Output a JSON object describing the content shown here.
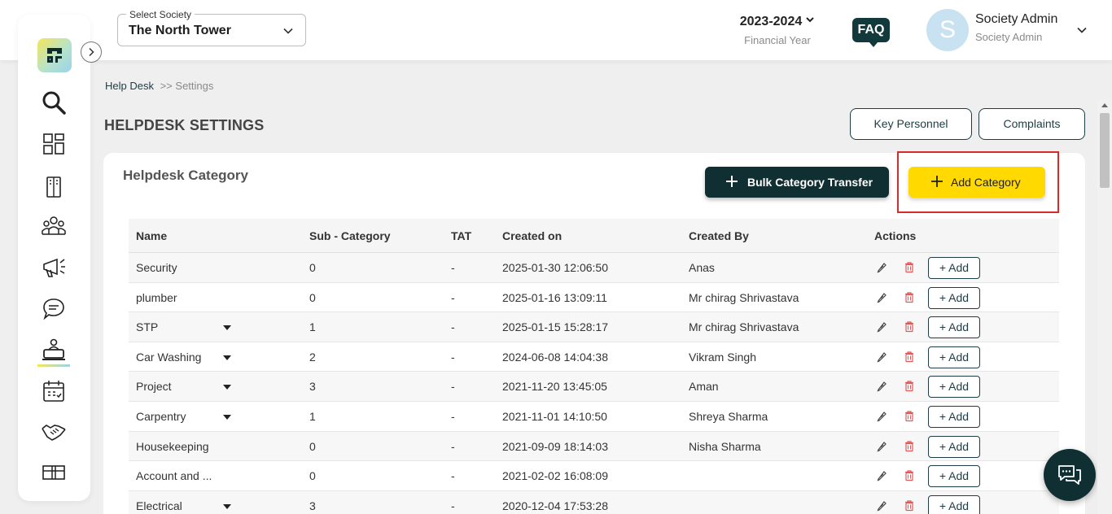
{
  "header": {
    "society_select": {
      "label": "Select Society",
      "value": "The North Tower"
    },
    "financial_year": {
      "value": "2023-2024",
      "label": "Financial Year"
    },
    "faq_label": "FAQ",
    "user": {
      "initial": "S",
      "name": "Society Admin",
      "role": "Society Admin"
    }
  },
  "sidebar": {
    "icons": [
      "search-icon",
      "dashboard-icon",
      "building-icon",
      "members-icon",
      "notice-icon",
      "chat-icon",
      "helpdesk-icon",
      "calendar-icon",
      "handshake-icon",
      "box-icon"
    ],
    "active": "helpdesk-icon"
  },
  "breadcrumb": {
    "parent": "Help Desk",
    "separator": ">>",
    "current": "Settings"
  },
  "page": {
    "title": "HELPDESK SETTINGS",
    "key_personnel_label": "Key Personnel",
    "complaints_label": "Complaints"
  },
  "card": {
    "title": "Helpdesk Category",
    "bulk_transfer_label": "Bulk Category Transfer",
    "add_category_label": "Add Category"
  },
  "table": {
    "headers": [
      "Name",
      "Sub - Category",
      "TAT",
      "Created on",
      "Created By",
      "Actions"
    ],
    "add_label": "+ Add",
    "rows": [
      {
        "name": "Security",
        "sub": "0",
        "tat": "-",
        "created_on": "2025-01-30 12:06:50",
        "created_by": "Anas",
        "expandable": false
      },
      {
        "name": "plumber",
        "sub": "0",
        "tat": "-",
        "created_on": "2025-01-16 13:09:11",
        "created_by": "Mr chirag Shrivastava",
        "expandable": false
      },
      {
        "name": "STP",
        "sub": "1",
        "tat": "-",
        "created_on": "2025-01-15 15:28:17",
        "created_by": "Mr chirag Shrivastava",
        "expandable": true
      },
      {
        "name": "Car Washing",
        "sub": "2",
        "tat": "-",
        "created_on": "2024-06-08 14:04:38",
        "created_by": "Vikram Singh",
        "expandable": true
      },
      {
        "name": "Project",
        "sub": "3",
        "tat": "-",
        "created_on": "2021-11-20 13:45:05",
        "created_by": "Aman",
        "expandable": true
      },
      {
        "name": "Carpentry",
        "sub": "1",
        "tat": "-",
        "created_on": "2021-11-01 14:10:50",
        "created_by": "Shreya Sharma",
        "expandable": true
      },
      {
        "name": "Housekeeping",
        "sub": "0",
        "tat": "-",
        "created_on": "2021-09-09 18:14:03",
        "created_by": "Nisha Sharma",
        "expandable": false
      },
      {
        "name": "Account and ...",
        "sub": "0",
        "tat": "-",
        "created_on": "2021-02-02 16:08:09",
        "created_by": "",
        "expandable": false
      },
      {
        "name": "Electrical",
        "sub": "3",
        "tat": "-",
        "created_on": "2020-12-04 17:53:28",
        "created_by": "",
        "expandable": true
      }
    ]
  },
  "colors": {
    "accent_dark": "#0f2f33",
    "accent_yellow": "#ffd900",
    "highlight_red": "#d52b2b"
  }
}
